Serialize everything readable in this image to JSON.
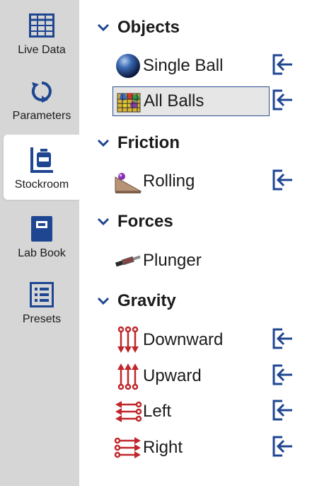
{
  "sidebar": {
    "items": [
      {
        "label": "Live Data",
        "icon": "table-grid-icon"
      },
      {
        "label": "Parameters",
        "icon": "refresh-icon"
      },
      {
        "label": "Stockroom",
        "icon": "stockroom-icon",
        "active": true
      },
      {
        "label": "Lab Book",
        "icon": "lab-book-icon"
      },
      {
        "label": "Presets",
        "icon": "presets-list-icon"
      }
    ]
  },
  "sections": [
    {
      "title": "Objects",
      "items": [
        {
          "label": "Single Ball",
          "icon": "ball-icon"
        },
        {
          "label": "All Balls",
          "icon": "ball-basket-icon",
          "selected": true
        }
      ]
    },
    {
      "title": "Friction",
      "items": [
        {
          "label": "Rolling",
          "icon": "ramp-ball-icon"
        }
      ]
    },
    {
      "title": "Forces",
      "items": [
        {
          "label": "Plunger",
          "icon": "plunger-icon"
        }
      ]
    },
    {
      "title": "Gravity",
      "items": [
        {
          "label": "Downward",
          "icon": "arrows-down-icon"
        },
        {
          "label": "Upward",
          "icon": "arrows-up-icon"
        },
        {
          "label": "Left",
          "icon": "arrows-left-icon"
        },
        {
          "label": "Right",
          "icon": "arrows-right-icon"
        }
      ]
    }
  ],
  "colors": {
    "accent": "#1f4691",
    "sidebar_bg": "#d6d6d6",
    "arrow_red": "#c0262a",
    "selection_border": "#2a4f8f"
  }
}
